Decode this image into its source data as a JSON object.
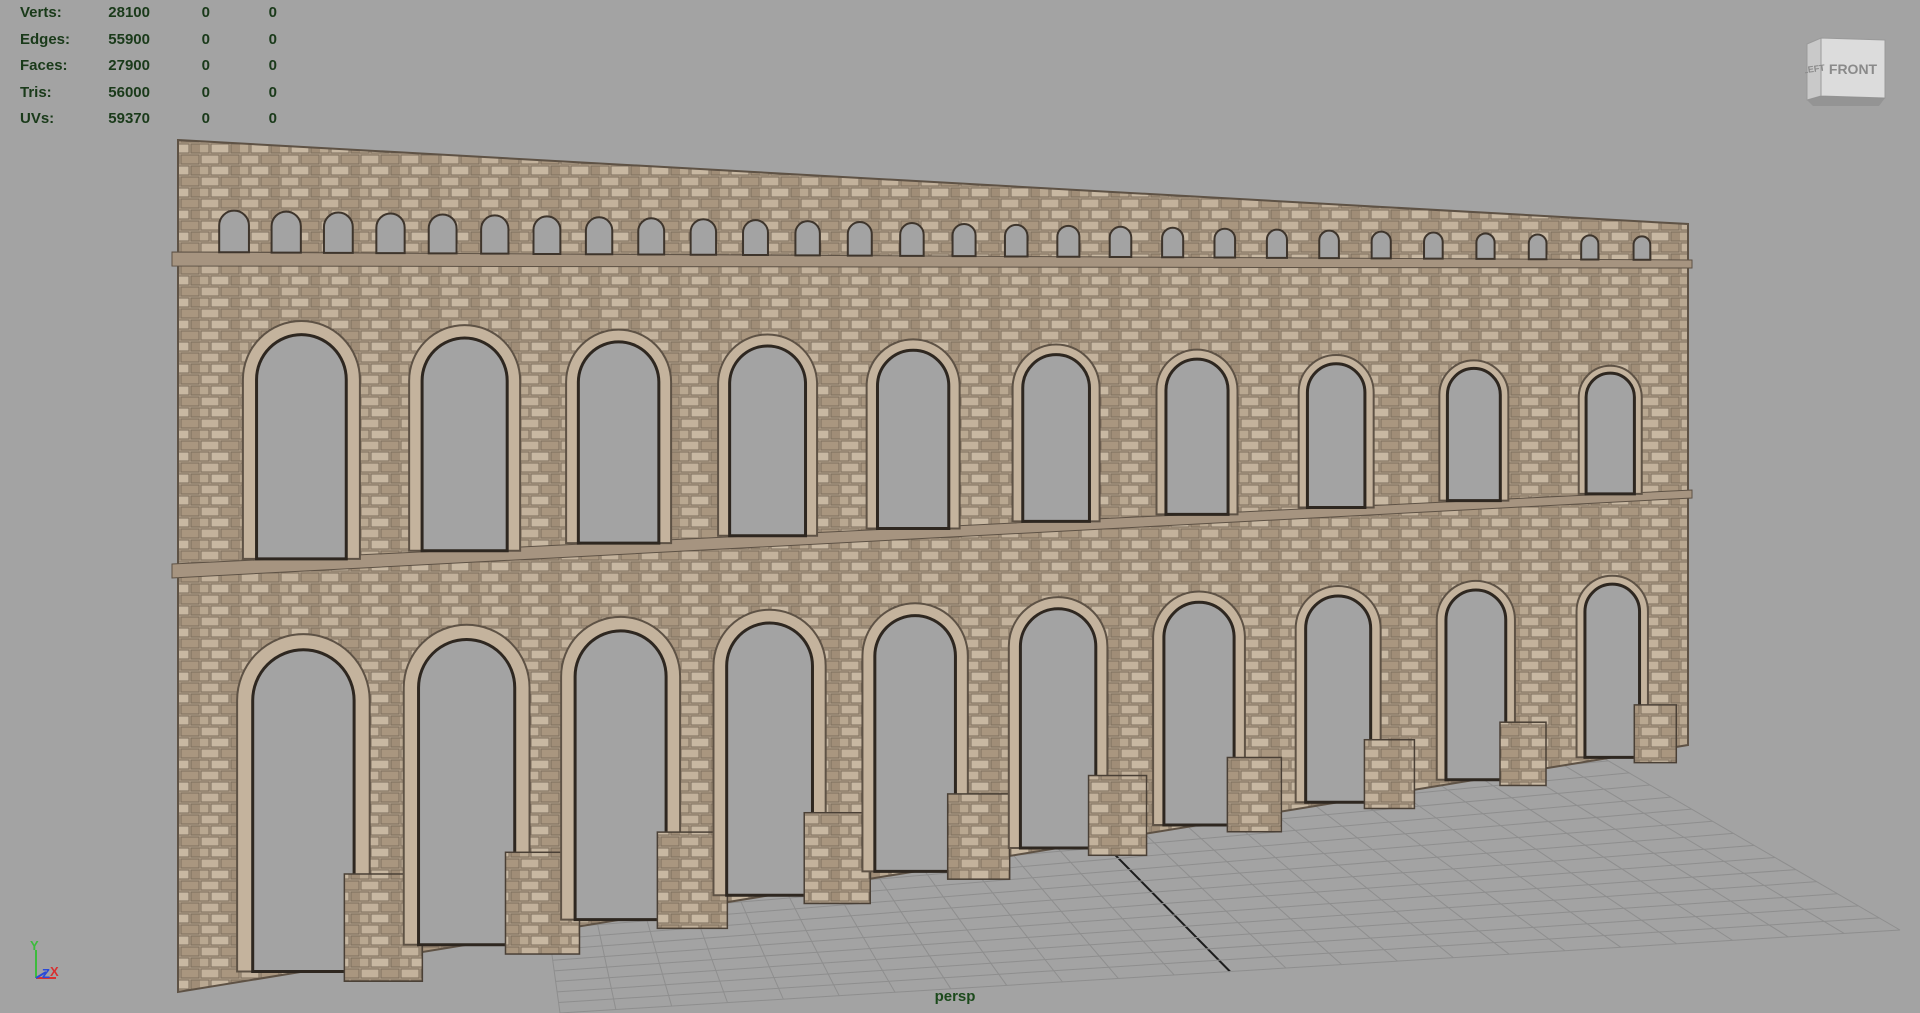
{
  "viewport": {
    "camera_label": "persp",
    "background_color": "#a3a3a3",
    "grid_color": "#8e8e8e",
    "grid_axis_color": "#1c1c1c",
    "stone_color": "#b7a590",
    "arch_count_upper": 10,
    "arch_count_lower": 10,
    "small_window_count": 28
  },
  "heads_up": {
    "rows": [
      {
        "label": "Verts:",
        "v1": "28100",
        "v2": "0",
        "v3": "0"
      },
      {
        "label": "Edges:",
        "v1": "55900",
        "v2": "0",
        "v3": "0"
      },
      {
        "label": "Faces:",
        "v1": "27900",
        "v2": "0",
        "v3": "0"
      },
      {
        "label": "Tris:",
        "v1": "56000",
        "v2": "0",
        "v3": "0"
      },
      {
        "label": "UVs:",
        "v1": "59370",
        "v2": "0",
        "v3": "0"
      }
    ]
  },
  "view_cube": {
    "left_face": "LEFT",
    "front_face": "FRONT"
  },
  "axis_indicator": {
    "y": "Y",
    "z": "Z",
    "x": "X",
    "y_color": "#3cbb3c",
    "z_color": "#2a4ad8",
    "x_color": "#d83030"
  }
}
